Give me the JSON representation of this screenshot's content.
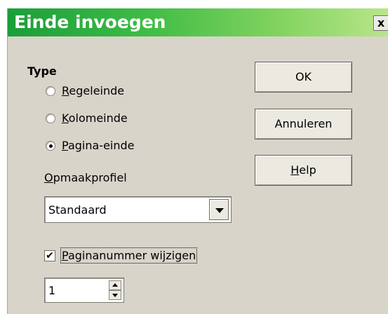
{
  "window": {
    "title": "Einde invoegen",
    "close_glyph": "x"
  },
  "type_section": {
    "label": "Type",
    "options": [
      {
        "mnemonic": "R",
        "rest": "egeleinde",
        "checked": false
      },
      {
        "mnemonic": "K",
        "rest": "olomeinde",
        "checked": false
      },
      {
        "mnemonic": "P",
        "rest": "agina-einde",
        "checked": true
      }
    ]
  },
  "style_field": {
    "mnemonic": "O",
    "rest": "pmaakprofiel",
    "selected": "Standaard"
  },
  "page_number": {
    "checkbox_checked": true,
    "check_glyph": "✔",
    "mnemonic": "P",
    "rest": "aginanummer wijzigen",
    "value": "1"
  },
  "buttons": {
    "ok": "OK",
    "cancel": "Annuleren",
    "help_mnemonic": "H",
    "help_rest": "elp"
  }
}
